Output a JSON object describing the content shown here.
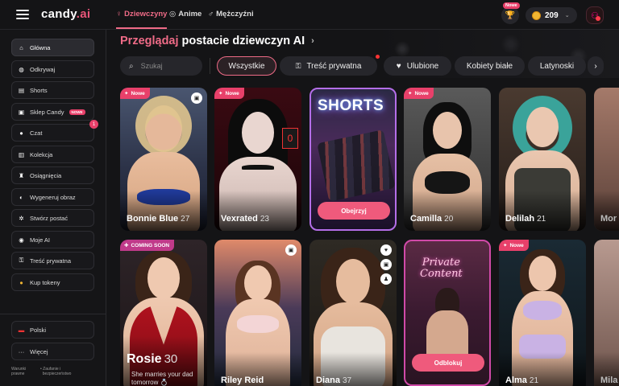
{
  "header": {
    "logo_text": "candy",
    "logo_suffix": ".ai",
    "tabs": [
      {
        "label": "Dziewczyny",
        "icon": "female-icon",
        "active": true
      },
      {
        "label": "Anime",
        "icon": "anime-icon",
        "active": false
      },
      {
        "label": "Mężczyźni",
        "icon": "male-icon",
        "active": false
      }
    ],
    "trophy_badge": "Nowe",
    "tokens": "209"
  },
  "sidebar": {
    "items": [
      {
        "label": "Główna",
        "icon": "home-icon"
      },
      {
        "label": "Odkrywaj",
        "icon": "compass-icon"
      },
      {
        "label": "Shorts",
        "icon": "shorts-icon"
      },
      {
        "label": "Sklep Candy",
        "icon": "shop-icon",
        "badge": "NOWE"
      },
      {
        "label": "Czat",
        "icon": "chat-icon",
        "count": "1"
      },
      {
        "label": "Kolekcja",
        "icon": "collection-icon"
      },
      {
        "label": "Osiągnięcia",
        "icon": "trophy-icon"
      },
      {
        "label": "Wygeneruj obraz",
        "icon": "image-icon"
      },
      {
        "label": "Stwórz postać",
        "icon": "wand-icon"
      },
      {
        "label": "Moje AI",
        "icon": "ai-icon"
      },
      {
        "label": "Treść prywatna",
        "icon": "lock-icon"
      },
      {
        "label": "Kup tokeny",
        "icon": "coin-icon"
      }
    ],
    "language": "Polski",
    "more": "Więcej",
    "footer_left": [
      "Warunki",
      "prawne"
    ],
    "footer_right": [
      "Zaufanie i",
      "bezpieczeństwo"
    ]
  },
  "main": {
    "heading_pink": "Przeglądaj",
    "heading_rest": "postacie dziewczyn AI",
    "search_placeholder": "Szukaj",
    "filters": [
      "Wszystkie",
      "Treść prywatna",
      "Ulubione",
      "Kobiety białe",
      "Latynoski"
    ],
    "cards": [
      {
        "name": "Bonnie Blue",
        "age": "27",
        "tag": "Nowe"
      },
      {
        "name": "Vexrated",
        "age": "23",
        "tag": "Nowe"
      },
      {
        "title": "SHORTS",
        "button": "Obejrzyj"
      },
      {
        "name": "Camilla",
        "age": "20",
        "tag": "Nowe"
      },
      {
        "name": "Delilah",
        "age": "21"
      },
      {
        "name": "Mor"
      },
      {
        "name": "Rosie",
        "age": "30",
        "tag": "COMING SOON",
        "subtitle": "She marries your dad tomorrow 💍"
      },
      {
        "name": "Riley Reid"
      },
      {
        "name": "Diana",
        "age": "37"
      },
      {
        "title_line1": "Private",
        "title_line2": "Content",
        "button": "Odblokuj"
      },
      {
        "name": "Alma",
        "age": "21",
        "tag": "Nowe"
      },
      {
        "name": "Mila"
      }
    ]
  },
  "colors": {
    "accent": "#ef6b87",
    "badge": "#e8406a",
    "bg": "#141416"
  }
}
